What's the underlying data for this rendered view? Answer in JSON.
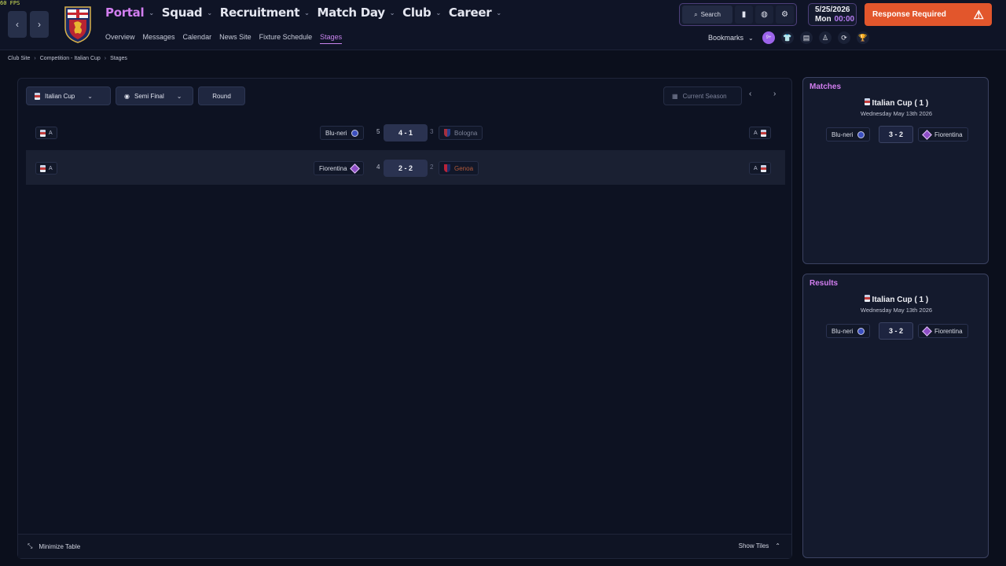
{
  "fps": "60 FPS",
  "colors": {
    "accent": "#d27ef0",
    "alert": "#e2562c",
    "panel": "#0d1222"
  },
  "nav": {
    "back_icon": "chevron-left-icon",
    "forward_icon": "chevron-right-icon"
  },
  "menu": [
    {
      "label": "Portal"
    },
    {
      "label": "Squad"
    },
    {
      "label": "Recruitment"
    },
    {
      "label": "Match Day"
    },
    {
      "label": "Club"
    },
    {
      "label": "Career"
    }
  ],
  "submenu": [
    "Overview",
    "Messages",
    "Calendar",
    "News Site",
    "Fixture Schedule",
    "Stages"
  ],
  "toolbar": {
    "search_label": "Search"
  },
  "datetime": {
    "date": "5/25/2026",
    "day": "Mon",
    "time": "00:00"
  },
  "alert": {
    "label": "Response Required"
  },
  "bookmarks": {
    "label": "Bookmarks",
    "badge": "9+"
  },
  "breadcrumb": [
    "Club Site",
    "Competition - Italian Cup",
    "Stages"
  ],
  "filters": {
    "competition": "Italian Cup",
    "stage": "Semi Final",
    "round": "Round",
    "season": "Current Season"
  },
  "matches": [
    {
      "tag_left": "A",
      "home": "Blu-neri",
      "home_pen": "5",
      "score": "4 - 1",
      "away_pen": "3",
      "away": "Bologna",
      "tag_right": "A"
    },
    {
      "tag_left": "A",
      "home": "Fiorentina",
      "home_pen": "4",
      "score": "2 - 2",
      "away_pen": "2",
      "away": "Genoa",
      "tag_right": "A"
    }
  ],
  "footer": {
    "minimize": "Minimize Table",
    "show_tiles": "Show Tiles"
  },
  "side_matches": {
    "heading": "Matches",
    "competition": "Italian Cup",
    "round": "( 1 )",
    "date": "Wednesday May 13th 2026",
    "home": "Blu-neri",
    "score": "3 - 2",
    "away": "Fiorentina"
  },
  "side_results": {
    "heading": "Results",
    "competition": "Italian Cup",
    "round": "( 1 )",
    "date": "Wednesday May 13th 2026",
    "home": "Blu-neri",
    "score": "3 - 2",
    "away": "Fiorentina"
  }
}
